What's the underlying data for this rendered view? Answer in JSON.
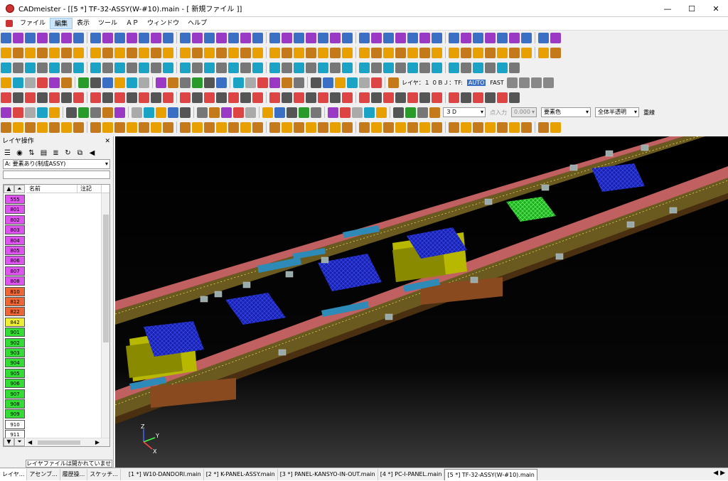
{
  "window": {
    "title": "CADmeister - [[5 *] TF-32-ASSY(W-#10).main - [ 新規ファイル ]]",
    "min": "—",
    "max": "☐",
    "close": "✕"
  },
  "menu": [
    "ファイル",
    "編集",
    "表示",
    "ツール",
    "ＡＰ",
    "ウィンドウ",
    "ヘルプ"
  ],
  "toolbar": {
    "layer_label": "レイヤ：１ ０ＢＪ：TF:",
    "auto": "AUTO",
    "fast": "FAST",
    "view_3d": "３Ｄ",
    "point_input_label": "点入力",
    "point_input_value": "0.000",
    "element_color": "要素色",
    "transparency": "全体半透明",
    "overlay": "重線"
  },
  "layer_panel": {
    "title": "レイヤ操作",
    "close": "✕",
    "filter": "A: 要素あり(制成ASSY)",
    "col_name": "名前",
    "col_note": "注記",
    "layers": [
      {
        "id": "555",
        "color": "#dd55ee"
      },
      {
        "id": "801",
        "color": "#dd55ee"
      },
      {
        "id": "802",
        "color": "#dd55ee"
      },
      {
        "id": "803",
        "color": "#dd55ee"
      },
      {
        "id": "804",
        "color": "#dd55ee"
      },
      {
        "id": "805",
        "color": "#dd55ee"
      },
      {
        "id": "806",
        "color": "#dd55ee"
      },
      {
        "id": "807",
        "color": "#dd55ee"
      },
      {
        "id": "808",
        "color": "#dd55ee"
      },
      {
        "id": "810",
        "color": "#ee6633"
      },
      {
        "id": "812",
        "color": "#ee6633"
      },
      {
        "id": "822",
        "color": "#ee6633"
      },
      {
        "id": "842",
        "color": "#eeee33"
      },
      {
        "id": "901",
        "color": "#33dd33"
      },
      {
        "id": "902",
        "color": "#33dd33"
      },
      {
        "id": "903",
        "color": "#33dd33"
      },
      {
        "id": "904",
        "color": "#33dd33"
      },
      {
        "id": "905",
        "color": "#33dd33"
      },
      {
        "id": "906",
        "color": "#33dd33"
      },
      {
        "id": "907",
        "color": "#33dd33"
      },
      {
        "id": "908",
        "color": "#33dd33"
      },
      {
        "id": "909",
        "color": "#33dd33"
      },
      {
        "id": "910",
        "color": "#ffffff"
      },
      {
        "id": "911",
        "color": "#ffffff"
      }
    ],
    "status": "レイヤファイルは開かれていません。"
  },
  "bottom_tabs": {
    "panel_tabs": [
      "レイヤ...",
      "アセンブ...",
      "履歴操...",
      "スケッチ..."
    ],
    "doc_tabs": [
      "[1 *] W10-DANDORI.main",
      "[2 *] K-PANEL-ASSY.main",
      "[3 *] PANEL-KANSYO-IN-OUT.main",
      "[4 *] PC-I-PANEL.main",
      "[5 *] TF-32-ASSY(W-#10).main"
    ],
    "nav": "◀ ▶"
  },
  "axis": {
    "x": "X",
    "y": "Y",
    "z": "Z"
  }
}
